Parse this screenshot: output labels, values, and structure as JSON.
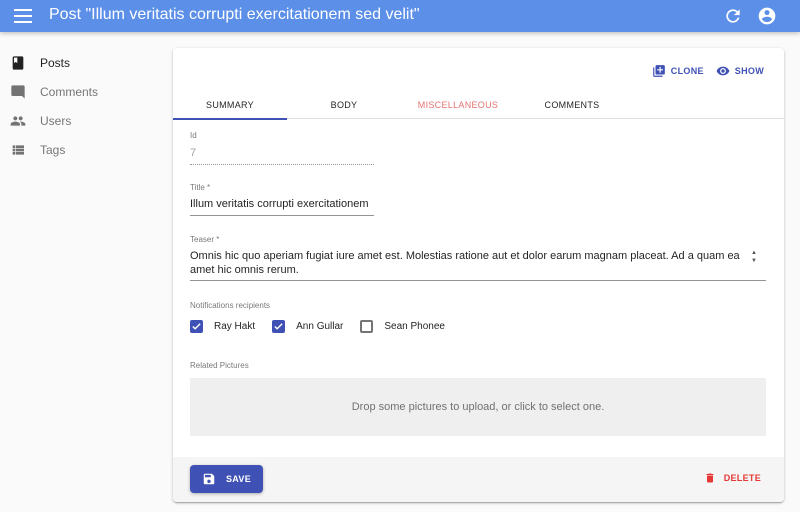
{
  "appbar": {
    "title": "Post \"Illum veritatis corrupti exercitationem sed velit\""
  },
  "sidebar": {
    "items": [
      {
        "label": "Posts",
        "icon": "book-icon",
        "active": true
      },
      {
        "label": "Comments",
        "icon": "chat-bubble-icon"
      },
      {
        "label": "Users",
        "icon": "people-icon"
      },
      {
        "label": "Tags",
        "icon": "list-icon"
      }
    ]
  },
  "actions": {
    "clone": "CLONE",
    "show": "SHOW"
  },
  "tabs": [
    {
      "label": "SUMMARY",
      "active": true
    },
    {
      "label": "BODY"
    },
    {
      "label": "MISCELLANEOUS",
      "error": true
    },
    {
      "label": "COMMENTS"
    }
  ],
  "form": {
    "id_label": "Id",
    "id_value": "7",
    "title_label": "Title *",
    "title_value": "Illum veritatis corrupti exercitationem sed velit",
    "teaser_label": "Teaser *",
    "teaser_value": "Omnis hic quo aperiam fugiat iure amet est. Molestias ratione aut et dolor earum magnam placeat. Ad a quam ea amet hic omnis rerum.",
    "notifications_label": "Notifications recipients",
    "recipients": [
      {
        "label": "Ray Hakt",
        "checked": true
      },
      {
        "label": "Ann Gullar",
        "checked": true
      },
      {
        "label": "Sean Phonee",
        "checked": false
      }
    ],
    "pictures_label": "Related Pictures",
    "dropzone_text": "Drop some pictures to upload, or click to select one."
  },
  "toolbar": {
    "save_label": "SAVE",
    "delete_label": "DELETE"
  },
  "colors": {
    "appbar": "#5b8fe8",
    "primary": "#3f51b5",
    "error_tab": "#e57373",
    "delete": "#e53935"
  }
}
